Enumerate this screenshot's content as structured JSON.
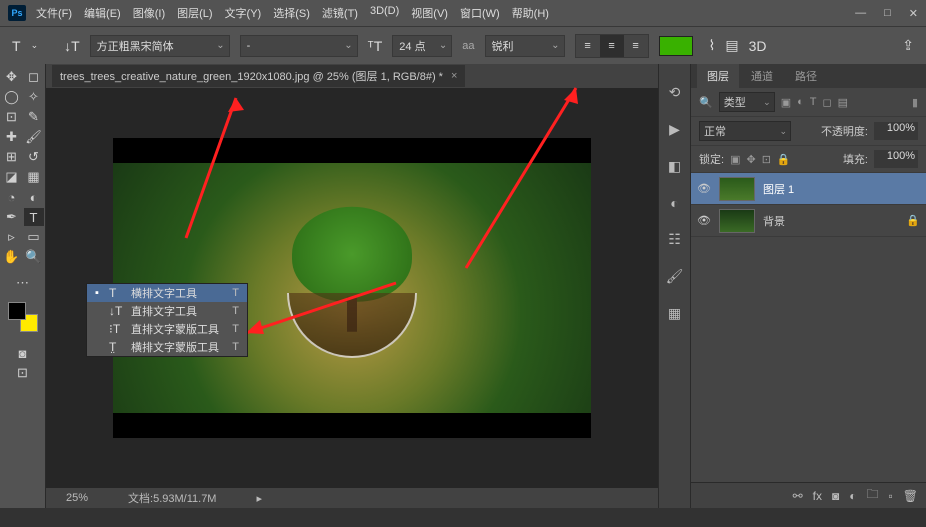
{
  "app": {
    "icon_text": "Ps"
  },
  "menu": {
    "items": [
      "文件(F)",
      "编辑(E)",
      "图像(I)",
      "图层(L)",
      "文字(Y)",
      "选择(S)",
      "滤镜(T)",
      "3D(D)",
      "视图(V)",
      "窗口(W)",
      "帮助(H)"
    ]
  },
  "options": {
    "font_family": "方正粗黑宋简体",
    "font_style": "-",
    "font_size": "24 点",
    "aa_label": "aa",
    "antialias": "锐利",
    "text_color": "#39b100"
  },
  "doc_tab": {
    "title": "trees_trees_creative_nature_green_1920x1080.jpg @ 25% (图层 1, RGB/8#) *"
  },
  "status": {
    "zoom": "25%",
    "file_info": "文档:5.93M/11.7M"
  },
  "type_tool_flyout": {
    "items": [
      {
        "icon": "T",
        "label": "横排文字工具",
        "shortcut": "T",
        "active": true
      },
      {
        "icon": "↓T",
        "label": "直排文字工具",
        "shortcut": "T",
        "active": false
      },
      {
        "icon": "⁝T",
        "label": "直排文字蒙版工具",
        "shortcut": "T",
        "active": false
      },
      {
        "icon": "T̤",
        "label": "横排文字蒙版工具",
        "shortcut": "T",
        "active": false
      }
    ]
  },
  "panels": {
    "tabs": [
      "图层",
      "通道",
      "路径"
    ],
    "search_label": "类型",
    "blend_mode": "正常",
    "opacity_label": "不透明度:",
    "opacity_value": "100%",
    "lock_label": "锁定:",
    "fill_label": "填充:",
    "fill_value": "100%",
    "layers": [
      {
        "name": "图层 1",
        "selected": true,
        "locked": false
      },
      {
        "name": "背景",
        "selected": false,
        "locked": true
      }
    ]
  },
  "chart_data": null
}
